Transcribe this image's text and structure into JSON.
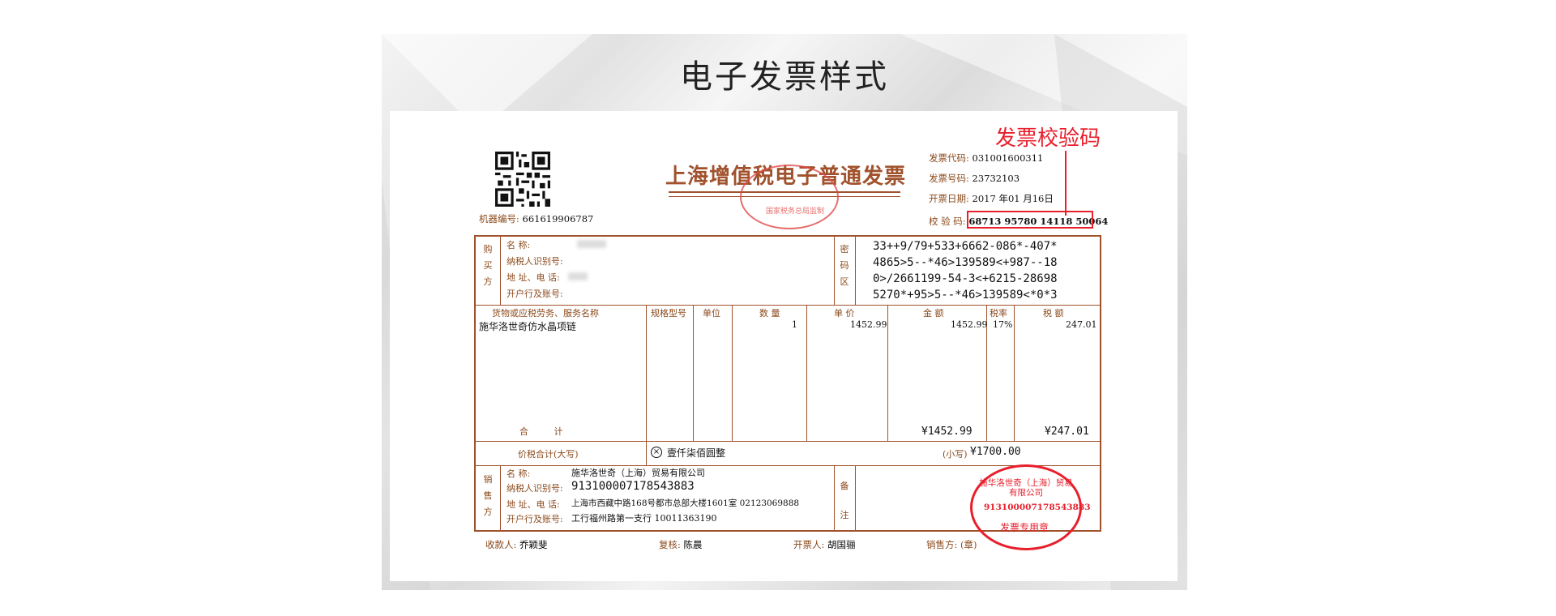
{
  "page_title": "电子发票样式",
  "annotation_label": "发票校验码",
  "invoice": {
    "title": "上海增值税电子普通发票",
    "official_stamp_text": "国家税务总局监制",
    "machine_no_label": "机器编号:",
    "machine_no": "661619906787",
    "code_label": "发票代码:",
    "code": "031001600311",
    "number_label": "发票号码:",
    "number": "23732103",
    "date_label": "开票日期:",
    "date": "2017 年01 月16日",
    "check_label": "校 验 码:",
    "check_code": "68713 95780 14118 50064",
    "buyer": {
      "section_label": [
        "购",
        "买",
        "方"
      ],
      "name_label": "名 称:",
      "taxid_label": "纳税人识别号:",
      "address_label": "地 址、电 话:",
      "bank_label": "开户行及账号:"
    },
    "cipher": {
      "section_label": [
        "密",
        "码",
        "区"
      ],
      "lines": [
        "33++9/79+533+6662-086*-407*",
        "4865>5--*46>139589<+987--18",
        "0>/2661199-54-3<+6215-28698",
        "5270*+95>5--*46>139589<*0*3"
      ]
    },
    "items": {
      "headers": [
        "货物或应税劳务、服务名称",
        "规格型号",
        "单位",
        "数 量",
        "单 价",
        "金 额",
        "税率",
        "税 额"
      ],
      "rows": [
        {
          "name": "施华洛世奇仿水晶项链",
          "spec": "",
          "unit": "",
          "qty": "1",
          "price": "1452.99",
          "amount": "1452.99",
          "rate": "17%",
          "tax": "247.01"
        }
      ],
      "total_label": "合 计",
      "total_amount": "¥1452.99",
      "total_tax": "¥247.01"
    },
    "grand_total": {
      "label": "价税合计(大写)",
      "uppercase": "壹仟柒佰圆整",
      "small_label": "(小写)",
      "value": "¥1700.00"
    },
    "seller": {
      "section_label": [
        "销",
        "售",
        "方"
      ],
      "name_label": "名 称:",
      "name": "施华洛世奇（上海）贸易有限公司",
      "taxid_label": "纳税人识别号:",
      "taxid": "913100007178543883",
      "address_label": "地 址、电 话:",
      "address": "上海市西藏中路168号都市总部大楼1601室 02123069888",
      "bank_label": "开户行及账号:",
      "bank": "工行福州路第一支行 10011363190",
      "remark_label": [
        "备",
        "注"
      ]
    },
    "seller_stamp": {
      "company": "施华洛世奇（上海）贸易有限公司",
      "taxid": "913100007178543883",
      "type": "发票专用章"
    },
    "footer": {
      "payee_label": "收款人:",
      "payee": "乔颖斐",
      "reviewer_label": "复核:",
      "reviewer": "陈晨",
      "issuer_label": "开票人:",
      "issuer": "胡国骊",
      "seller_label": "销售方: (章)"
    }
  },
  "colors": {
    "accent_red": "#e81f2c",
    "invoice_brown": "#a0522d"
  }
}
